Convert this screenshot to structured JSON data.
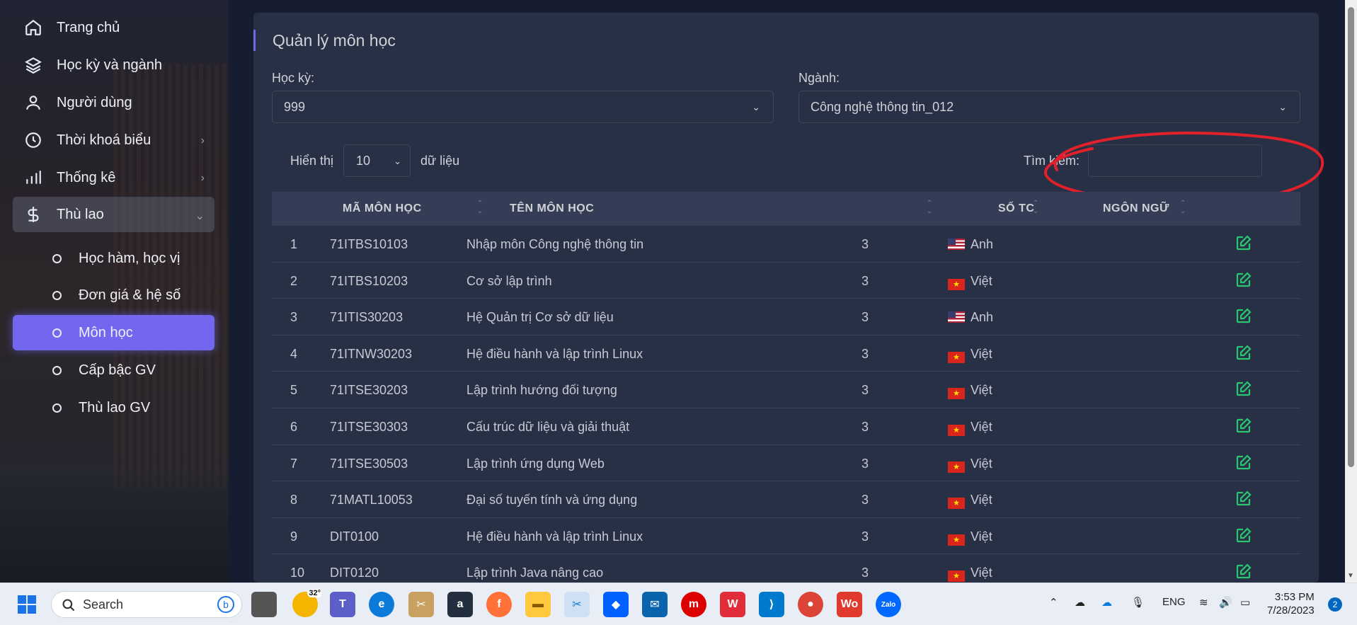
{
  "sidebar": {
    "items": [
      {
        "label": "Trang chủ",
        "icon": "home-icon"
      },
      {
        "label": "Học kỳ và ngành",
        "icon": "layers-icon"
      },
      {
        "label": "Người dùng",
        "icon": "user-icon"
      },
      {
        "label": "Thời khoá biểu",
        "icon": "clock-icon"
      },
      {
        "label": "Thống kê",
        "icon": "bar-chart-icon"
      },
      {
        "label": "Thù lao",
        "icon": "dollar-icon"
      }
    ],
    "subitems": [
      {
        "label": "Học hàm, học vị"
      },
      {
        "label": "Đơn giá & hệ số"
      },
      {
        "label": "Môn học"
      },
      {
        "label": "Cấp bậc GV"
      },
      {
        "label": "Thù lao GV"
      }
    ]
  },
  "page": {
    "title": "Quản lý môn học",
    "semester_label": "Học kỳ:",
    "semester_value": "999",
    "major_label": "Ngành:",
    "major_value": "Công nghệ thông tin_012",
    "show_label": "Hiển thị",
    "show_value": "10",
    "show_suffix": "dữ liệu",
    "search_label": "Tìm kiếm:"
  },
  "table": {
    "headers": {
      "code": "MÃ MÔN HỌC",
      "name": "TÊN MÔN HỌC",
      "credits": "SỐ TC",
      "language": "NGÔN NGỮ"
    },
    "rows": [
      {
        "no": "1",
        "code": "71ITBS10103",
        "name": "Nhập môn Công nghệ thông tin",
        "credits": "3",
        "lang": "Anh",
        "flag": "us"
      },
      {
        "no": "2",
        "code": "71ITBS10203",
        "name": "Cơ sở lập trình",
        "credits": "3",
        "lang": "Việt",
        "flag": "vn"
      },
      {
        "no": "3",
        "code": "71ITIS30203",
        "name": "Hệ Quản trị Cơ sở dữ liệu",
        "credits": "3",
        "lang": "Anh",
        "flag": "us"
      },
      {
        "no": "4",
        "code": "71ITNW30203",
        "name": "Hệ điều hành và lập trình Linux",
        "credits": "3",
        "lang": "Việt",
        "flag": "vn"
      },
      {
        "no": "5",
        "code": "71ITSE30203",
        "name": "Lập trình hướng đối tượng",
        "credits": "3",
        "lang": "Việt",
        "flag": "vn"
      },
      {
        "no": "6",
        "code": "71ITSE30303",
        "name": "Cấu trúc dữ liệu và giải thuật",
        "credits": "3",
        "lang": "Việt",
        "flag": "vn"
      },
      {
        "no": "7",
        "code": "71ITSE30503",
        "name": "Lập trình ứng dụng Web",
        "credits": "3",
        "lang": "Việt",
        "flag": "vn"
      },
      {
        "no": "8",
        "code": "71MATL10053",
        "name": "Đại số tuyến tính và ứng dụng",
        "credits": "3",
        "lang": "Việt",
        "flag": "vn"
      },
      {
        "no": "9",
        "code": "DIT0100",
        "name": "Hệ điều hành và lập trình Linux",
        "credits": "3",
        "lang": "Việt",
        "flag": "vn"
      },
      {
        "no": "10",
        "code": "DIT0120",
        "name": "Lập trình Java nâng cao",
        "credits": "3",
        "lang": "Việt",
        "flag": "vn"
      }
    ]
  },
  "taskbar": {
    "search_placeholder": "Search",
    "weather": "32°",
    "language": "ENG",
    "time": "3:53 PM",
    "date": "7/28/2023",
    "notifications": "2"
  },
  "colors": {
    "accent": "#7367f0",
    "edit": "#28c76f",
    "annotation": "#e0202a"
  }
}
